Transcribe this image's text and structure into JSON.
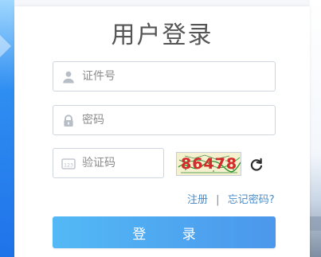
{
  "title": "用户登录",
  "username": {
    "placeholder": "证件号",
    "icon": "user-icon"
  },
  "password": {
    "placeholder": "密码",
    "icon": "lock-icon"
  },
  "captcha": {
    "placeholder": "验证码",
    "icon": "captcha-icon",
    "code": "86478",
    "refresh_icon": "refresh-icon"
  },
  "links": {
    "register": "注册",
    "separator": "|",
    "forgot_password": "忘记密码?"
  },
  "login_button": "登 录",
  "colors": {
    "primary_button_start": "#53b9f5",
    "primary_button_end": "#4b97ec",
    "link": "#4a8bc8",
    "title": "#555555",
    "border": "#cfd6df"
  }
}
